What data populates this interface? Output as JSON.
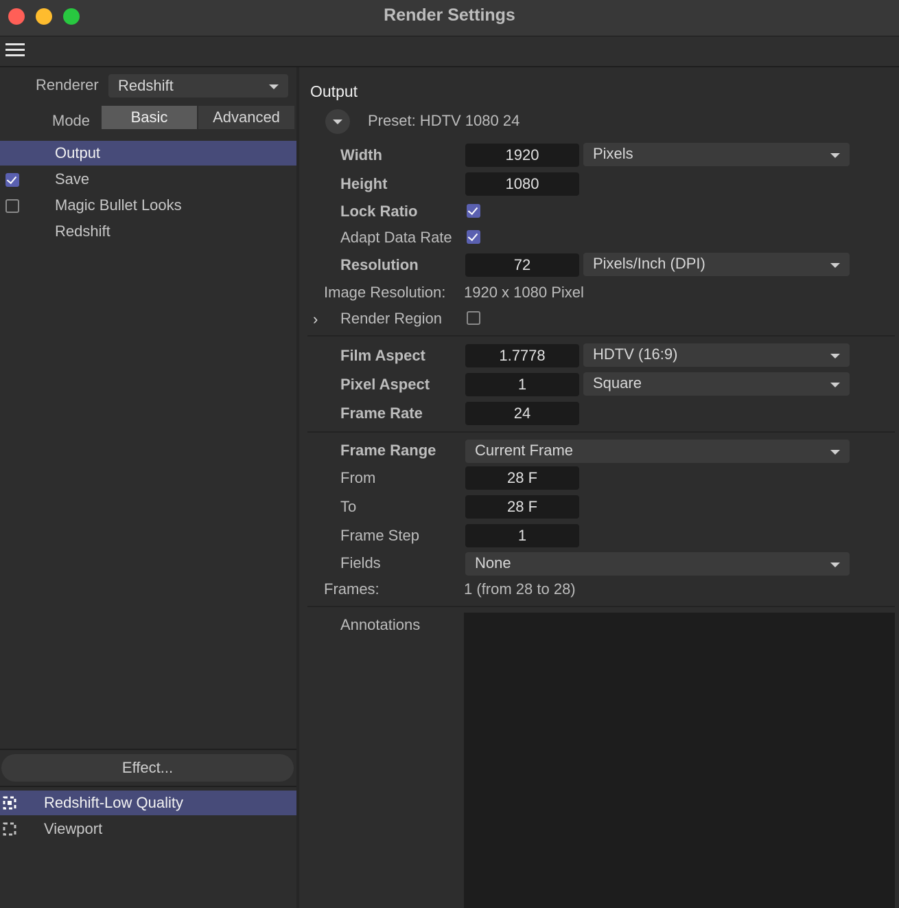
{
  "window": {
    "title": "Render Settings"
  },
  "left": {
    "renderer_label": "Renderer",
    "renderer_value": "Redshift",
    "mode_label": "Mode",
    "mode_tabs": [
      "Basic",
      "Advanced"
    ],
    "nav": [
      {
        "label": "Output",
        "checkbox": "none",
        "selected": true
      },
      {
        "label": "Save",
        "checkbox": "checked",
        "selected": false
      },
      {
        "label": "Magic Bullet Looks",
        "checkbox": "unchecked",
        "selected": false
      },
      {
        "label": "Redshift",
        "checkbox": "none",
        "selected": false
      }
    ],
    "effect_button": "Effect...",
    "settings_list": [
      {
        "label": "Redshift-Low Quality",
        "selected": true
      },
      {
        "label": "Viewport",
        "selected": false
      }
    ]
  },
  "output": {
    "heading": "Output",
    "preset": "Preset: HDTV 1080 24",
    "width_label": "Width",
    "width_value": "1920",
    "width_unit": "Pixels",
    "height_label": "Height",
    "height_value": "1080",
    "lock_ratio_label": "Lock Ratio",
    "lock_ratio": true,
    "adapt_label": "Adapt Data Rate",
    "adapt": true,
    "resolution_label": "Resolution",
    "resolution_value": "72",
    "resolution_unit": "Pixels/Inch (DPI)",
    "image_res_label": "Image Resolution:",
    "image_res_value": "1920 x 1080 Pixel",
    "render_region_label": "Render Region",
    "render_region": false,
    "film_aspect_label": "Film Aspect",
    "film_aspect_value": "1.7778",
    "film_aspect_preset": "HDTV (16:9)",
    "pixel_aspect_label": "Pixel Aspect",
    "pixel_aspect_value": "1",
    "pixel_aspect_preset": "Square",
    "frame_rate_label": "Frame Rate",
    "frame_rate_value": "24",
    "frame_range_label": "Frame Range",
    "frame_range_value": "Current Frame",
    "from_label": "From",
    "from_value": "28 F",
    "to_label": "To",
    "to_value": "28 F",
    "frame_step_label": "Frame Step",
    "frame_step_value": "1",
    "fields_label": "Fields",
    "fields_value": "None",
    "frames_label": "Frames:",
    "frames_value": "1 (from 28 to 28)",
    "annotations_label": "Annotations",
    "annotations_value": ""
  },
  "colors": {
    "accent_selection": "#474b79",
    "checkbox_on": "#5a60b0",
    "traffic_red": "#ff5f57",
    "traffic_yellow": "#febc2e",
    "traffic_green": "#28c840"
  },
  "icons": {
    "menu": "hamburger-icon",
    "preset_toggle": "chevron-down-icon",
    "region_expand": "chevron-right-icon",
    "render_setting": "dashed-square-icon"
  }
}
